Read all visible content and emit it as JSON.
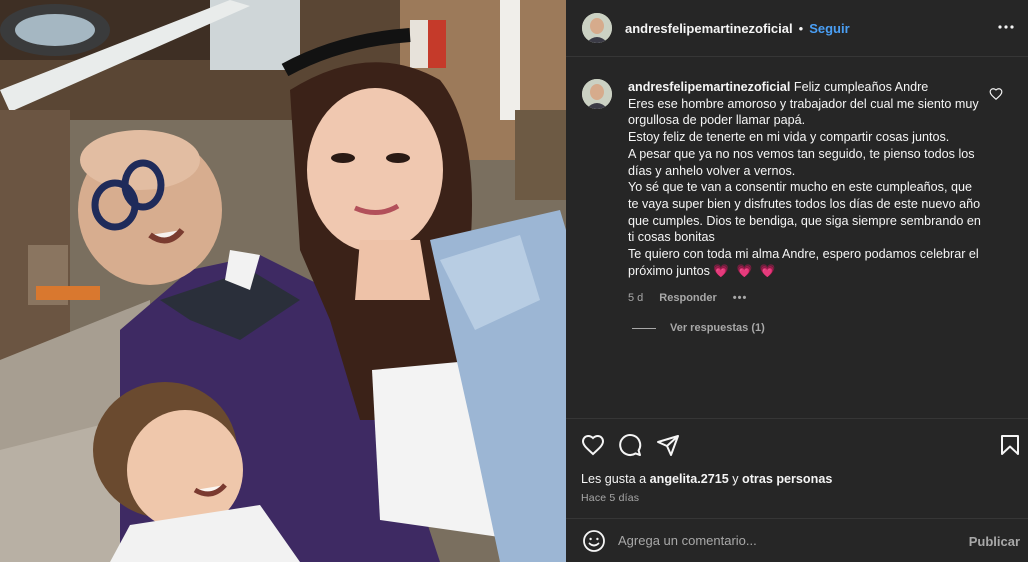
{
  "photo": {
    "alt_icon": "post-photo"
  },
  "header": {
    "username": "andresfelipemartinezoficial",
    "separator": "•",
    "follow_label": "Seguir",
    "more_icon": "more-horizontal-icon"
  },
  "caption": {
    "username": "andresfelipemartinezoficial",
    "lines": [
      "Feliz cumpleaños Andre",
      "Eres ese hombre amoroso y trabajador del cual me siento muy",
      "orgullosa de poder llamar papá.",
      "Estoy feliz de tenerte en mi vida y compartir cosas juntos.",
      "A pesar que ya no nos vemos tan seguido, te pienso todos los",
      "días y anhelo volver a vernos.",
      "Yo sé que te van a consentir mucho en este cumpleaños, que",
      "te vaya super bien y disfrutes todos los días de este nuevo año",
      "que cumples. Dios te bendiga, que siga siempre sembrando en",
      "ti cosas bonitas",
      "Te quiero con toda mi alma Andre, espero podamos celebrar el",
      "próximo juntos"
    ],
    "hearts": "💗 💗 💗",
    "age": "5 d",
    "reply_label": "Responder",
    "options_label": "•••",
    "view_replies": "Ver respuestas (1)"
  },
  "actions": {
    "likes_prefix": "Les gusta a",
    "likes_user": "angelita.2715",
    "likes_middle": "y",
    "likes_others": "otras personas",
    "time_ago": "Hace 5 días"
  },
  "composer": {
    "placeholder": "Agrega un comentario...",
    "publish_label": "Publicar"
  },
  "colors": {
    "panel_bg": "#262626",
    "accent": "#4a9ff5",
    "text": "#f5f5f5",
    "muted": "#a8a8a8",
    "heart": "#ff4fa8"
  }
}
